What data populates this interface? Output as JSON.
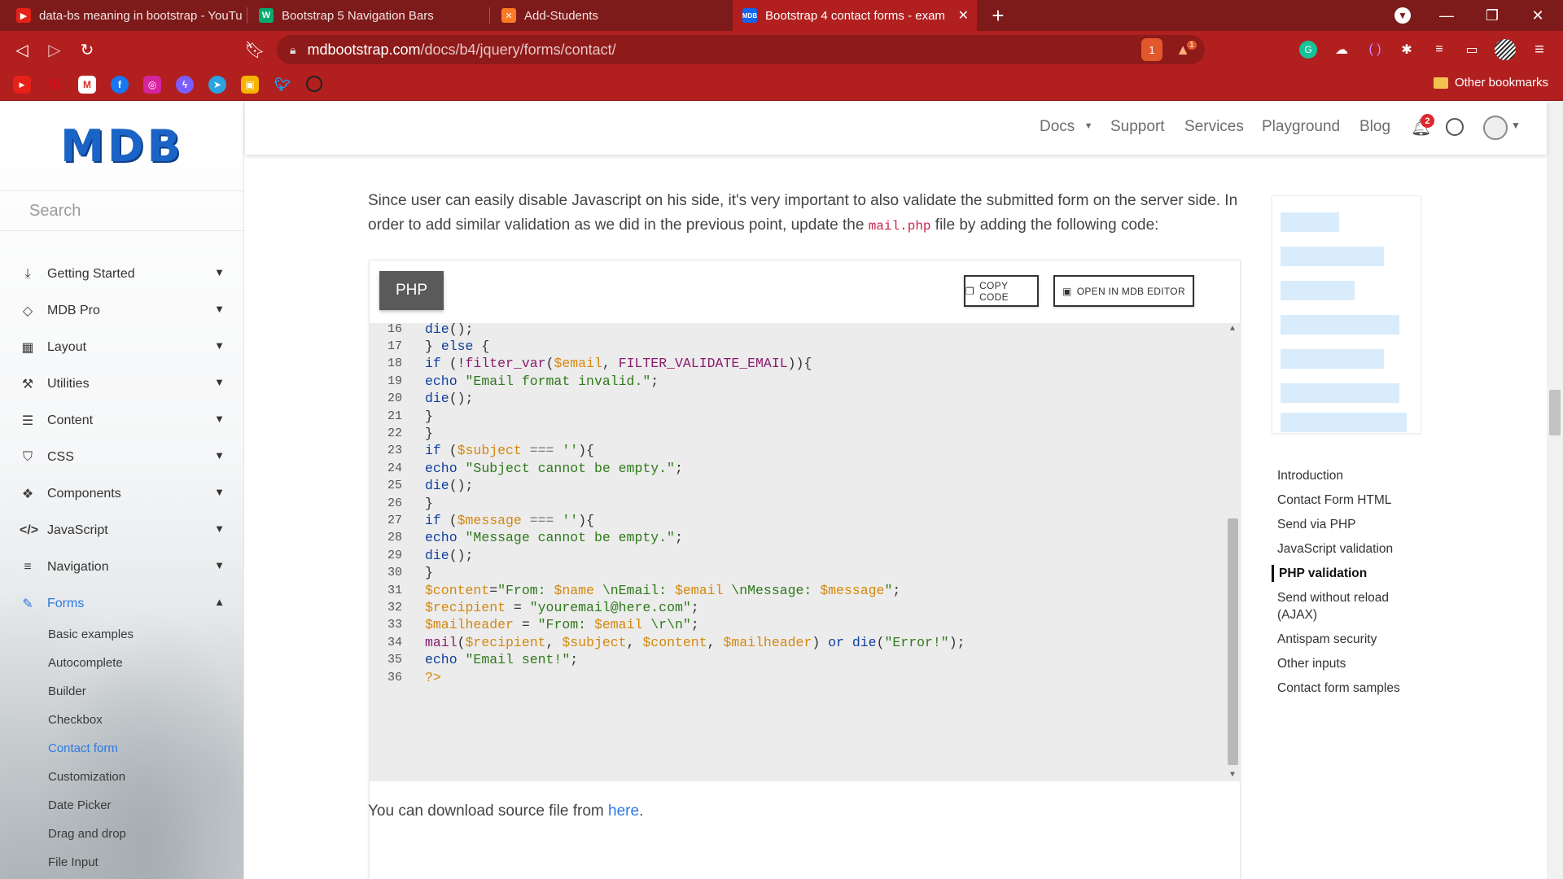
{
  "browser": {
    "tabs": [
      {
        "title": "data-bs meaning in bootstrap - YouTu",
        "icon": "youtube-icon",
        "color": "#e62117"
      },
      {
        "title": "Bootstrap 5 Navigation Bars",
        "icon": "w3schools-icon",
        "color": "#04aa6d"
      },
      {
        "title": "Add-Students",
        "icon": "xampp-icon",
        "color": "#fb7a24"
      },
      {
        "title": "Bootstrap 4 contact forms - exam",
        "icon": "mdb-icon",
        "color": "#1266f1"
      }
    ],
    "new_tab_label": "+",
    "url_host": "mdbootstrap.com",
    "url_path": "/docs/b4/jquery/forms/contact/",
    "brave_shield_count": "1",
    "rewards_count": "1",
    "other_bookmarks": "Other bookmarks"
  },
  "sidebar": {
    "logo": "MDB",
    "search_placeholder": "Search",
    "items": [
      {
        "label": "Getting Started",
        "icon": "download-icon"
      },
      {
        "label": "MDB Pro",
        "icon": "gem-icon"
      },
      {
        "label": "Layout",
        "icon": "grid-icon"
      },
      {
        "label": "Utilities",
        "icon": "tools-icon"
      },
      {
        "label": "Content",
        "icon": "list-icon"
      },
      {
        "label": "CSS",
        "icon": "css3-icon"
      },
      {
        "label": "Components",
        "icon": "cubes-icon"
      },
      {
        "label": "JavaScript",
        "icon": "code-icon"
      },
      {
        "label": "Navigation",
        "icon": "bars-icon"
      },
      {
        "label": "Forms",
        "icon": "edit-icon"
      }
    ],
    "forms_submenu": [
      "Basic examples",
      "Autocomplete",
      "Builder",
      "Checkbox",
      "Contact form",
      "Customization",
      "Date Picker",
      "Drag and drop",
      "File Input"
    ]
  },
  "topnav": {
    "links": [
      "Docs",
      "Support",
      "Services",
      "Playground",
      "Blog"
    ],
    "notification_count": "2"
  },
  "main": {
    "intro_part1": "Since user can easily disable Javascript on his side, it's very important to also validate the submitted form on the server side. In order to add similar validation as we did in the previous point, update the ",
    "intro_code": "mail.php",
    "intro_part2": " file by adding the following code:",
    "code_lang": "PHP",
    "copy_label": "COPY CODE",
    "editor_label": "OPEN IN MDB EDITOR",
    "code_lines": [
      {
        "n": "16",
        "code": "die();"
      },
      {
        "n": "17",
        "code": "} else {"
      },
      {
        "n": "18",
        "code": "if (!filter_var($email, FILTER_VALIDATE_EMAIL)){"
      },
      {
        "n": "19",
        "code": "echo \"Email format invalid.\";"
      },
      {
        "n": "20",
        "code": "die();"
      },
      {
        "n": "21",
        "code": "}"
      },
      {
        "n": "22",
        "code": "}"
      },
      {
        "n": "23",
        "code": "if ($subject === ''){"
      },
      {
        "n": "24",
        "code": "echo \"Subject cannot be empty.\";"
      },
      {
        "n": "25",
        "code": "die();"
      },
      {
        "n": "26",
        "code": "}"
      },
      {
        "n": "27",
        "code": "if ($message === ''){"
      },
      {
        "n": "28",
        "code": "echo \"Message cannot be empty.\";"
      },
      {
        "n": "29",
        "code": "die();"
      },
      {
        "n": "30",
        "code": "}"
      },
      {
        "n": "31",
        "code": "$content=\"From: $name \\nEmail: $email \\nMessage: $message\";"
      },
      {
        "n": "32",
        "code": "$recipient = \"youremail@here.com\";"
      },
      {
        "n": "33",
        "code": "$mailheader = \"From: $email \\r\\n\";"
      },
      {
        "n": "34",
        "code": "mail($recipient, $subject, $content, $mailheader) or die(\"Error!\");"
      },
      {
        "n": "35",
        "code": "echo \"Email sent!\";"
      },
      {
        "n": "36",
        "code": "?>"
      }
    ],
    "outro_text": "You can download source file from ",
    "outro_link": "here",
    "outro_end": "."
  },
  "toc": {
    "items": [
      "Introduction",
      "Contact Form HTML",
      "Send via PHP",
      "JavaScript validation",
      "PHP validation",
      "Send without reload (AJAX)",
      "Antispam security",
      "Other inputs",
      "Contact form samples"
    ],
    "active": "PHP validation"
  },
  "colors": {
    "chrome_dark": "#7d1a1a",
    "chrome": "#b11f1f",
    "accent": "#2c78e4",
    "code_bg": "#ececec"
  }
}
